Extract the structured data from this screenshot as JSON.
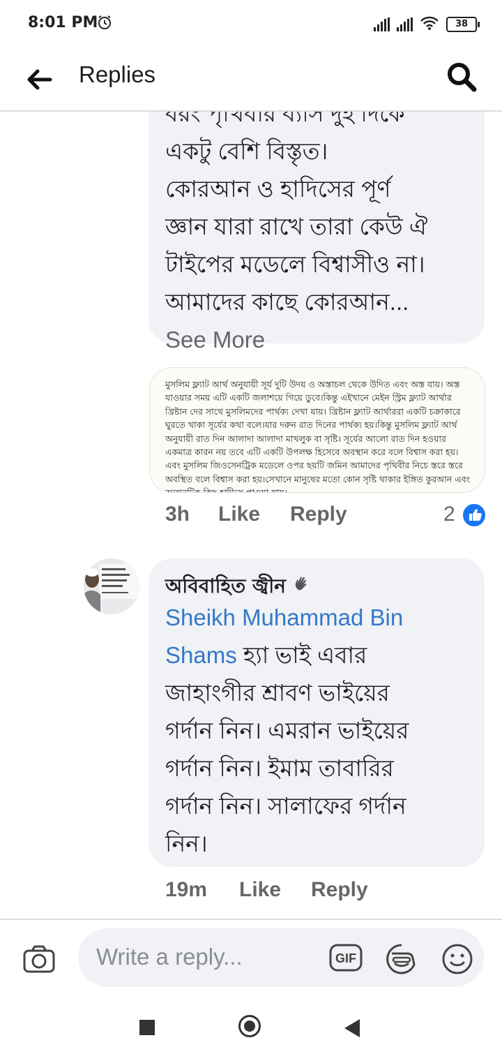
{
  "status_bar": {
    "time": "8:01 PM",
    "battery": "38"
  },
  "header": {
    "title": "Replies"
  },
  "comment1": {
    "lines": [
      "বরং পৃথিবীর ব্যাস দুই দিকে",
      "একটু বেশি বিস্তৃত।",
      "কোরআন ও হাদিসের পূর্ণ",
      "জ্ঞান যারা রাখে তারা কেউ ঐ",
      "টাইপের মডেলে বিশ্বাসীও না।",
      "আমাদের কাছে কোরআন..."
    ],
    "see_more": "See More",
    "attachment_text": "মুসলিম ফ্ল্যাট আর্থ অনুযায়ী সূর্য দুটি উদয় ও অস্তাচল থেকে উদিত এবং অস্ত যায়। অস্ত যাওয়ার সময় এটি একটি জলাশয়ে গিয়ে ডুবে।কিন্তু এইখানে মেইন স্ট্রিম ফ্ল্যাট আর্থার খ্রিষ্টান দের সাথে মুসলিমদের পার্থক্য দেখা যায়। খ্রিষ্টান ফ্ল্যাট আর্থাররা একটি চক্রাকারে ঘুরতে থাকা সূর্যের কথা বলে।যার দরুন রাত দিনের পার্থক্য হয়।কিন্তু মুসলিম ফ্ল্যাট আর্থ অনুযায়ী রাত দিন আলাদা আলাদা মাখলুক বা সৃষ্টি। সূর্যের আলো রাত দিন হওয়ার একমাত্র কারন নয় তবে এটি একটি উপলক্ষ হিসেবে অবস্থান করে বলে বিশ্বাস করা হয়।এবং মুসলিম জিওসেনট্রিক মডেলে ওপর ছয়টি জমিন আমাদের পৃথিবীর নিচে স্তরে স্তরে অবস্থিত বলে বিশ্বাস করা হয়।সেখানে মানুষের মতো কোন সৃষ্টি থাকার ইঙ্গিত কুরআন এবং অথেনটিক কিছু হাদীসে পাওয়া যায়।",
    "time": "3h",
    "like": "Like",
    "reply": "Reply",
    "reaction_count": "2"
  },
  "comment2": {
    "author": "অবিবাহিত জ্বীন",
    "mention_line1": "Sheikh Muhammad Bin",
    "mention_line2": "Shams",
    "line2_rest": "হ্যা ভাই এবার",
    "lines": [
      "জাহাংগীর শ্রাবণ ভাইয়ের",
      "গর্দান নিন। এমরান ভাইয়ের",
      "গর্দান নিন। ইমাম তাবারির",
      "গর্দান নিন। সালাফের গর্দান",
      "নিন।"
    ],
    "time": "19m",
    "like": "Like",
    "reply": "Reply"
  },
  "composer": {
    "placeholder": "Write a reply...",
    "gif_label": "GIF"
  },
  "icons": {
    "back": "arrow-left-icon",
    "search": "search-icon",
    "camera": "camera-icon",
    "gif": "gif-icon",
    "sticker": "sticker-icon",
    "emoji": "emoji-icon",
    "like_reaction": "thumbs-up-icon",
    "waving": "waving-hand-icon"
  },
  "colors": {
    "mention": "#3578c9",
    "bubble": "#f0f2f5",
    "reaction": "#1877f2",
    "muted": "#65676b"
  }
}
